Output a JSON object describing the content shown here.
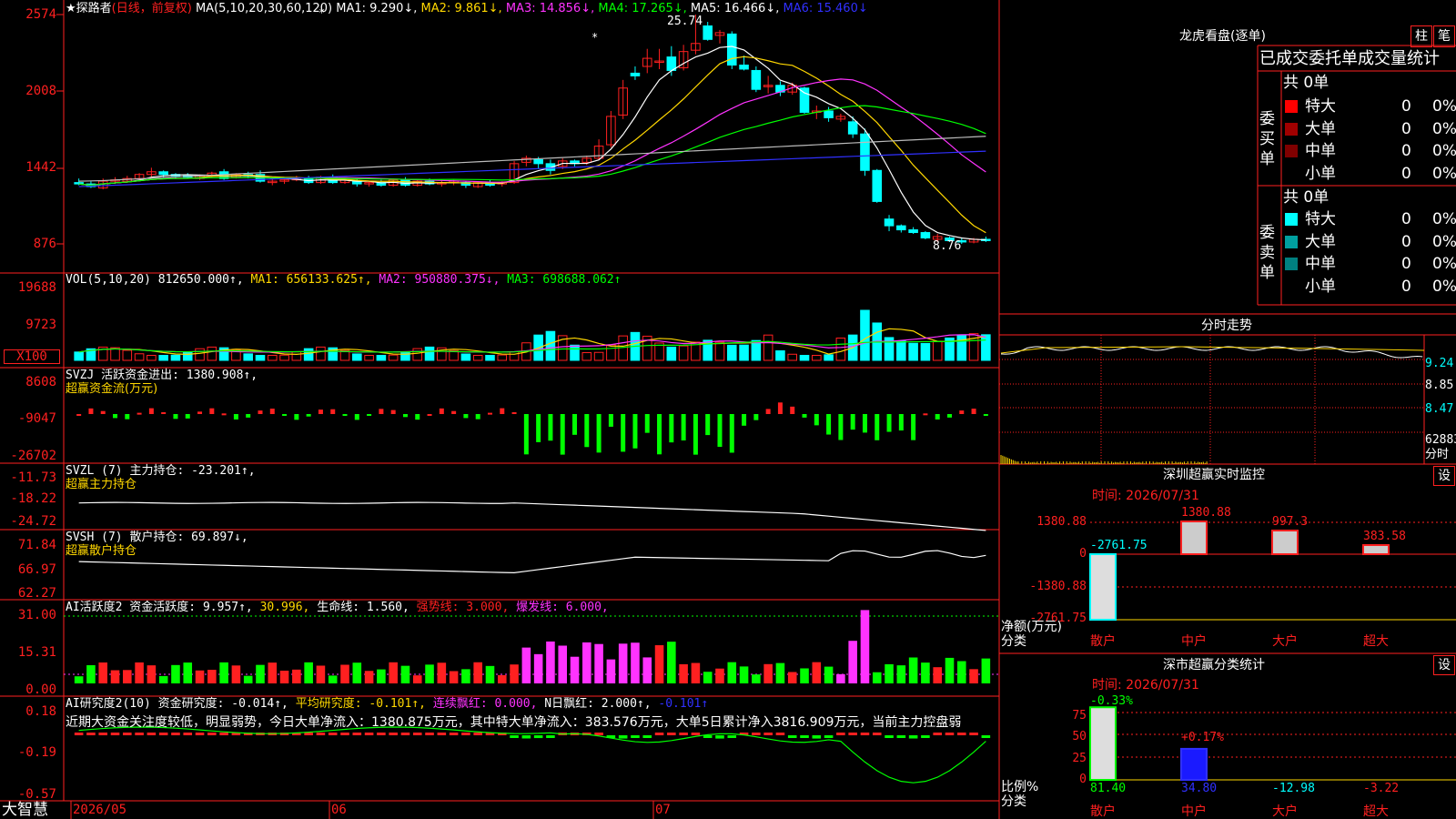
{
  "colors": {
    "up": "#ff2020",
    "down": "#00ffff",
    "grid": "#ff2020",
    "yellow": "#ffd700",
    "magenta": "#ff33ff",
    "green": "#00ff00",
    "white": "#ffffff",
    "blue": "#3030ff"
  },
  "price_panel": {
    "title": "★探路者",
    "period": "(日线，前复权)",
    "ma_label": "MA(5,10,20,30,60,120)",
    "ma1": "MA1: 9.290↓,",
    "ma2": "MA2: 9.861↓,",
    "ma3": "MA3: 14.856↓,",
    "ma4": "MA4: 17.265↓,",
    "ma5": "MA5: 16.466↓,",
    "ma6": "MA6: 15.460↓",
    "axis": [
      "2574",
      "2008",
      "1442",
      "876"
    ],
    "high_label": "25.74",
    "low_label": "8.76"
  },
  "vol_panel": {
    "label": "VOL(5,10,20) 812650.000↑,",
    "ma1": "MA1: 656133.625↑,",
    "ma2": "MA2: 950880.375↓,",
    "ma3": "MA3: 698688.062↑",
    "axis": [
      "19688",
      "9723"
    ],
    "unit": "X100"
  },
  "svzj_panel": {
    "label": "SVZJ  活跃资金进出: 1380.908↑,",
    "sub": "超赢资金流(万元)",
    "axis": [
      "8608",
      "-9047",
      "-26702"
    ]
  },
  "svzl_panel": {
    "label": "SVZL (7) 主力持仓: -23.201↑,",
    "sub": "超赢主力持仓",
    "axis": [
      "-11.73",
      "-18.22",
      "-24.72"
    ]
  },
  "svsh_panel": {
    "label": "SVSH (7) 散户持仓: 69.897↓,",
    "sub": "超赢散户持仓",
    "axis": [
      "71.84",
      "66.97",
      "62.27"
    ]
  },
  "ai1_panel": {
    "label": "AI活跃度2 资金活跃度: 9.957↑,",
    "v2": "30.996,",
    "v3": "生命线: 1.560,",
    "v4": "强势线: 3.000,",
    "v5": "爆发线: 6.000,",
    "axis": [
      "31.00",
      "15.31",
      "0.00"
    ]
  },
  "ai2_panel": {
    "label": "AI研究度2(10) 资金研究度: -0.014↑,",
    "v2": "平均研究度: -0.101↑,",
    "v3": "连续飘红: 0.000,",
    "v4": "N日飘红: 2.000↑,",
    "v5": "-0.101↑",
    "comment": "近期大资金关注度较低，明显弱势，今日大单净流入：1380.875万元，其中特大单净流入：383.576万元，大单5日累计净入3816.909万元，当前主力控盘弱",
    "axis": [
      "0.18",
      "-0.19",
      "-0.57"
    ]
  },
  "bottom": {
    "brand": "大智慧",
    "dates": [
      "2026/05",
      "06",
      "07"
    ]
  },
  "right": {
    "lhb_title": "龙虎看盘(逐单)",
    "btn_zhu": "柱",
    "btn_bi": "笔",
    "tabs_line": "已成交委托单成交量统计",
    "buy_group": "委买单",
    "sell_group": "委卖单",
    "buy_total": "共 0单",
    "sell_total": "共 0单",
    "buy_rows": [
      {
        "label": "特大",
        "count": "0",
        "pct": "0%",
        "color": "#ff0000"
      },
      {
        "label": "大单",
        "count": "0",
        "pct": "0%",
        "color": "#a00000"
      },
      {
        "label": "中单",
        "count": "0",
        "pct": "0%",
        "color": "#800000"
      },
      {
        "label": "小单",
        "count": "0",
        "pct": "0%",
        "color": ""
      }
    ],
    "sell_rows": [
      {
        "label": "特大",
        "count": "0",
        "pct": "0%",
        "color": "#00ffff"
      },
      {
        "label": "大单",
        "count": "0",
        "pct": "0%",
        "color": "#00a0a0"
      },
      {
        "label": "中单",
        "count": "0",
        "pct": "0%",
        "color": "#008080"
      },
      {
        "label": "小单",
        "count": "0",
        "pct": "0%",
        "color": ""
      }
    ],
    "intraday_title": "分时走势",
    "intraday_axis": [
      "9.24",
      "8.85",
      "8.47"
    ],
    "intraday_vol": "62883",
    "intraday_unit": "分时",
    "monitor_title": "深圳超赢实时监控",
    "monitor_set": "设",
    "monitor_time": "时间: 2026/07/31",
    "monitor_axis": [
      "1380.88",
      "0",
      "-1380.88",
      "-2761.75"
    ],
    "monitor_ylabel": "净额(万元)",
    "monitor_xlabel": "分类",
    "monitor_bars": [
      {
        "cat": "散户",
        "value": -2761.75,
        "label": "-2761.75"
      },
      {
        "cat": "中户",
        "value": 1380.88,
        "label": "1380.88"
      },
      {
        "cat": "大户",
        "value": 997.3,
        "label": "997.3"
      },
      {
        "cat": "超大",
        "value": 383.58,
        "label": "383.58"
      }
    ],
    "stat_title": "深市超赢分类统计",
    "stat_set": "设",
    "stat_time": "时间: 2026/07/31",
    "stat_axis": [
      "75",
      "50",
      "25",
      "0"
    ],
    "stat_ylabel": "比例%",
    "stat_xlabel": "分类",
    "stat_bars": [
      {
        "cat": "散户",
        "value": 81.4,
        "top": "-0.33%",
        "bottom": "81.40"
      },
      {
        "cat": "中户",
        "value": 34.8,
        "top": "+0.17%",
        "bottom": "34.80"
      },
      {
        "cat": "大户",
        "value": -12.98,
        "top": "",
        "bottom": "-12.98"
      },
      {
        "cat": "超大",
        "value": -3.22,
        "top": "",
        "bottom": "-3.22"
      }
    ]
  },
  "chart_data": {
    "type": "candlestick",
    "ylim": [
      8.76,
      25.74
    ],
    "candles": [
      {
        "o": 13.3,
        "h": 13.6,
        "l": 13.1,
        "c": 13.2
      },
      {
        "o": 13.2,
        "h": 13.4,
        "l": 12.9,
        "c": 13.0
      },
      {
        "o": 12.9,
        "h": 13.6,
        "l": 12.8,
        "c": 13.4
      },
      {
        "o": 13.4,
        "h": 13.7,
        "l": 13.2,
        "c": 13.5
      },
      {
        "o": 13.4,
        "h": 13.8,
        "l": 13.3,
        "c": 13.6
      },
      {
        "o": 13.6,
        "h": 14.0,
        "l": 13.5,
        "c": 13.9
      },
      {
        "o": 13.9,
        "h": 14.4,
        "l": 13.7,
        "c": 14.1
      },
      {
        "o": 14.1,
        "h": 14.2,
        "l": 13.7,
        "c": 13.9
      },
      {
        "o": 13.9,
        "h": 14.0,
        "l": 13.6,
        "c": 13.8
      },
      {
        "o": 13.8,
        "h": 14.0,
        "l": 13.6,
        "c": 13.7
      },
      {
        "o": 13.6,
        "h": 13.9,
        "l": 13.5,
        "c": 13.8
      },
      {
        "o": 13.8,
        "h": 14.1,
        "l": 13.7,
        "c": 14.0
      },
      {
        "o": 14.1,
        "h": 14.3,
        "l": 13.5,
        "c": 13.6
      },
      {
        "o": 13.7,
        "h": 14.0,
        "l": 13.6,
        "c": 13.9
      },
      {
        "o": 13.9,
        "h": 14.1,
        "l": 13.6,
        "c": 13.8
      },
      {
        "o": 13.9,
        "h": 14.2,
        "l": 13.3,
        "c": 13.4
      },
      {
        "o": 13.3,
        "h": 13.6,
        "l": 13.1,
        "c": 13.4
      },
      {
        "o": 13.4,
        "h": 13.7,
        "l": 13.2,
        "c": 13.5
      },
      {
        "o": 13.5,
        "h": 13.8,
        "l": 13.4,
        "c": 13.6
      },
      {
        "o": 13.6,
        "h": 13.8,
        "l": 13.2,
        "c": 13.3
      },
      {
        "o": 13.3,
        "h": 13.8,
        "l": 13.2,
        "c": 13.7
      },
      {
        "o": 13.7,
        "h": 13.9,
        "l": 13.2,
        "c": 13.3
      },
      {
        "o": 13.3,
        "h": 13.6,
        "l": 13.2,
        "c": 13.5
      },
      {
        "o": 13.4,
        "h": 13.6,
        "l": 13.0,
        "c": 13.2
      },
      {
        "o": 13.2,
        "h": 13.4,
        "l": 13.0,
        "c": 13.3
      },
      {
        "o": 13.3,
        "h": 13.5,
        "l": 13.0,
        "c": 13.1
      },
      {
        "o": 13.1,
        "h": 13.6,
        "l": 13.0,
        "c": 13.5
      },
      {
        "o": 13.5,
        "h": 13.7,
        "l": 13.0,
        "c": 13.1
      },
      {
        "o": 13.1,
        "h": 13.5,
        "l": 13.0,
        "c": 13.4
      },
      {
        "o": 13.4,
        "h": 13.6,
        "l": 13.1,
        "c": 13.2
      },
      {
        "o": 13.2,
        "h": 13.5,
        "l": 13.0,
        "c": 13.3
      },
      {
        "o": 13.3,
        "h": 13.5,
        "l": 13.1,
        "c": 13.4
      },
      {
        "o": 13.3,
        "h": 13.4,
        "l": 12.9,
        "c": 13.1
      },
      {
        "o": 13.0,
        "h": 13.4,
        "l": 12.9,
        "c": 13.3
      },
      {
        "o": 13.3,
        "h": 13.5,
        "l": 13.0,
        "c": 13.1
      },
      {
        "o": 13.2,
        "h": 13.4,
        "l": 13.0,
        "c": 13.3
      },
      {
        "o": 13.3,
        "h": 14.9,
        "l": 13.2,
        "c": 14.7
      },
      {
        "o": 14.8,
        "h": 15.3,
        "l": 14.5,
        "c": 15.1
      },
      {
        "o": 15.0,
        "h": 15.2,
        "l": 14.3,
        "c": 14.7
      },
      {
        "o": 14.7,
        "h": 15.0,
        "l": 13.9,
        "c": 14.2
      },
      {
        "o": 14.5,
        "h": 15.1,
        "l": 14.3,
        "c": 14.9
      },
      {
        "o": 14.9,
        "h": 15.0,
        "l": 14.5,
        "c": 14.7
      },
      {
        "o": 14.8,
        "h": 15.3,
        "l": 14.6,
        "c": 15.1
      },
      {
        "o": 15.1,
        "h": 16.5,
        "l": 15.0,
        "c": 16.0
      },
      {
        "o": 16.1,
        "h": 18.6,
        "l": 15.9,
        "c": 18.2
      },
      {
        "o": 18.3,
        "h": 20.9,
        "l": 18.0,
        "c": 20.3
      },
      {
        "o": 21.4,
        "h": 21.9,
        "l": 20.9,
        "c": 21.2
      },
      {
        "o": 21.9,
        "h": 23.2,
        "l": 21.4,
        "c": 22.5
      },
      {
        "o": 22.3,
        "h": 23.2,
        "l": 21.7,
        "c": 22.3
      },
      {
        "o": 22.6,
        "h": 23.4,
        "l": 21.2,
        "c": 21.6
      },
      {
        "o": 21.8,
        "h": 23.5,
        "l": 21.6,
        "c": 23.0
      },
      {
        "o": 23.1,
        "h": 25.74,
        "l": 22.8,
        "c": 23.6
      },
      {
        "o": 24.9,
        "h": 25.2,
        "l": 23.8,
        "c": 23.9
      },
      {
        "o": 24.2,
        "h": 24.6,
        "l": 23.6,
        "c": 24.4
      },
      {
        "o": 24.3,
        "h": 24.5,
        "l": 21.7,
        "c": 22.0
      },
      {
        "o": 22.0,
        "h": 22.7,
        "l": 21.6,
        "c": 21.7
      },
      {
        "o": 21.6,
        "h": 21.9,
        "l": 20.0,
        "c": 20.2
      },
      {
        "o": 20.5,
        "h": 21.2,
        "l": 19.9,
        "c": 20.5
      },
      {
        "o": 20.5,
        "h": 20.8,
        "l": 19.7,
        "c": 20.0
      },
      {
        "o": 20.0,
        "h": 20.7,
        "l": 19.8,
        "c": 20.5
      },
      {
        "o": 20.3,
        "h": 20.4,
        "l": 18.4,
        "c": 18.5
      },
      {
        "o": 18.5,
        "h": 19.0,
        "l": 18.0,
        "c": 18.6
      },
      {
        "o": 18.6,
        "h": 18.9,
        "l": 17.8,
        "c": 18.1
      },
      {
        "o": 18.0,
        "h": 18.4,
        "l": 17.8,
        "c": 18.2
      },
      {
        "o": 17.8,
        "h": 18.2,
        "l": 16.6,
        "c": 16.9
      },
      {
        "o": 16.9,
        "h": 17.3,
        "l": 13.8,
        "c": 14.2
      },
      {
        "o": 14.2,
        "h": 14.3,
        "l": 11.8,
        "c": 11.9
      },
      {
        "o": 10.6,
        "h": 10.9,
        "l": 9.7,
        "c": 10.1
      },
      {
        "o": 10.1,
        "h": 10.2,
        "l": 9.6,
        "c": 9.8
      },
      {
        "o": 9.8,
        "h": 10.0,
        "l": 9.5,
        "c": 9.6
      },
      {
        "o": 9.6,
        "h": 9.7,
        "l": 9.1,
        "c": 9.2
      },
      {
        "o": 9.1,
        "h": 9.5,
        "l": 8.9,
        "c": 9.3
      },
      {
        "o": 9.2,
        "h": 9.3,
        "l": 8.9,
        "c": 9.0
      },
      {
        "o": 9.0,
        "h": 9.2,
        "l": 8.76,
        "c": 8.9
      },
      {
        "o": 8.9,
        "h": 9.2,
        "l": 8.8,
        "c": 9.1
      },
      {
        "o": 9.1,
        "h": 9.3,
        "l": 8.9,
        "c": 9.0
      }
    ]
  }
}
